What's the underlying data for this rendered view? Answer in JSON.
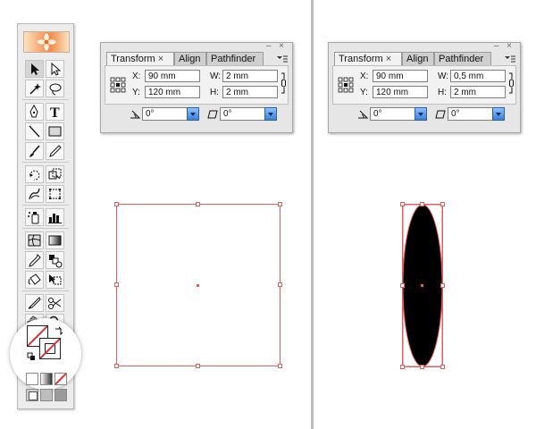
{
  "toolbox": {
    "tools": [
      "selection-arrow-icon",
      "direct-selection-arrow-icon",
      "magic-wand-icon",
      "lasso-icon",
      "pen-icon",
      "type-icon",
      "line-segment-icon",
      "rectangle-icon",
      "paintbrush-icon",
      "pencil-icon",
      "rotate-icon",
      "scale-icon",
      "warp-icon",
      "free-transform-icon",
      "symbol-sprayer-icon",
      "column-graph-icon",
      "mesh-icon",
      "gradient-icon",
      "eyedropper-icon",
      "blend-icon",
      "live-paint-bucket-icon",
      "live-paint-selection-icon",
      "slice-icon",
      "scissors-icon",
      "hand-icon",
      "zoom-icon"
    ]
  },
  "panels": [
    {
      "tabs": [
        {
          "label": "Transform",
          "close": "×",
          "active": true
        },
        {
          "label": "Align",
          "active": false
        },
        {
          "label": "Pathfinder",
          "active": false
        }
      ],
      "x_label": "X:",
      "x_value": "90 mm",
      "y_label": "Y:",
      "y_value": "120 mm",
      "w_label": "W:",
      "w_value": "2 mm",
      "h_label": "H:",
      "h_value": "2 mm",
      "rotate_value": "0°",
      "shear_value": "0°",
      "window_controls": "– ×"
    },
    {
      "tabs": [
        {
          "label": "Transform",
          "close": "×",
          "active": true
        },
        {
          "label": "Align",
          "active": false
        },
        {
          "label": "Pathfinder",
          "active": false
        }
      ],
      "x_label": "X:",
      "x_value": "90 mm",
      "y_label": "Y:",
      "y_value": "120 mm",
      "w_label": "W:",
      "w_value": "0,5 mm",
      "h_label": "H:",
      "h_value": "2 mm",
      "rotate_value": "0°",
      "shear_value": "0°",
      "window_controls": "– ×"
    }
  ],
  "artboard": {
    "selection_color": "#e35d5d",
    "ellipse_fill": "#000000"
  }
}
